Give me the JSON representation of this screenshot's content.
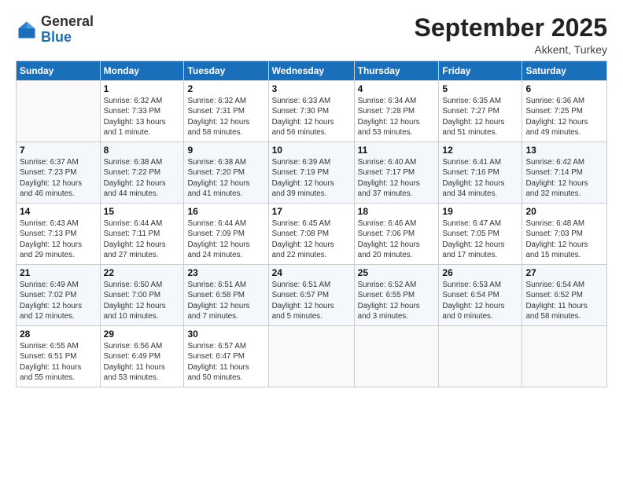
{
  "header": {
    "logo_general": "General",
    "logo_blue": "Blue",
    "month_title": "September 2025",
    "location": "Akkent, Turkey"
  },
  "days_of_week": [
    "Sunday",
    "Monday",
    "Tuesday",
    "Wednesday",
    "Thursday",
    "Friday",
    "Saturday"
  ],
  "weeks": [
    [
      {
        "day": "",
        "info": ""
      },
      {
        "day": "1",
        "info": "Sunrise: 6:32 AM\nSunset: 7:33 PM\nDaylight: 13 hours\nand 1 minute."
      },
      {
        "day": "2",
        "info": "Sunrise: 6:32 AM\nSunset: 7:31 PM\nDaylight: 12 hours\nand 58 minutes."
      },
      {
        "day": "3",
        "info": "Sunrise: 6:33 AM\nSunset: 7:30 PM\nDaylight: 12 hours\nand 56 minutes."
      },
      {
        "day": "4",
        "info": "Sunrise: 6:34 AM\nSunset: 7:28 PM\nDaylight: 12 hours\nand 53 minutes."
      },
      {
        "day": "5",
        "info": "Sunrise: 6:35 AM\nSunset: 7:27 PM\nDaylight: 12 hours\nand 51 minutes."
      },
      {
        "day": "6",
        "info": "Sunrise: 6:36 AM\nSunset: 7:25 PM\nDaylight: 12 hours\nand 49 minutes."
      }
    ],
    [
      {
        "day": "7",
        "info": "Sunrise: 6:37 AM\nSunset: 7:23 PM\nDaylight: 12 hours\nand 46 minutes."
      },
      {
        "day": "8",
        "info": "Sunrise: 6:38 AM\nSunset: 7:22 PM\nDaylight: 12 hours\nand 44 minutes."
      },
      {
        "day": "9",
        "info": "Sunrise: 6:38 AM\nSunset: 7:20 PM\nDaylight: 12 hours\nand 41 minutes."
      },
      {
        "day": "10",
        "info": "Sunrise: 6:39 AM\nSunset: 7:19 PM\nDaylight: 12 hours\nand 39 minutes."
      },
      {
        "day": "11",
        "info": "Sunrise: 6:40 AM\nSunset: 7:17 PM\nDaylight: 12 hours\nand 37 minutes."
      },
      {
        "day": "12",
        "info": "Sunrise: 6:41 AM\nSunset: 7:16 PM\nDaylight: 12 hours\nand 34 minutes."
      },
      {
        "day": "13",
        "info": "Sunrise: 6:42 AM\nSunset: 7:14 PM\nDaylight: 12 hours\nand 32 minutes."
      }
    ],
    [
      {
        "day": "14",
        "info": "Sunrise: 6:43 AM\nSunset: 7:13 PM\nDaylight: 12 hours\nand 29 minutes."
      },
      {
        "day": "15",
        "info": "Sunrise: 6:44 AM\nSunset: 7:11 PM\nDaylight: 12 hours\nand 27 minutes."
      },
      {
        "day": "16",
        "info": "Sunrise: 6:44 AM\nSunset: 7:09 PM\nDaylight: 12 hours\nand 24 minutes."
      },
      {
        "day": "17",
        "info": "Sunrise: 6:45 AM\nSunset: 7:08 PM\nDaylight: 12 hours\nand 22 minutes."
      },
      {
        "day": "18",
        "info": "Sunrise: 6:46 AM\nSunset: 7:06 PM\nDaylight: 12 hours\nand 20 minutes."
      },
      {
        "day": "19",
        "info": "Sunrise: 6:47 AM\nSunset: 7:05 PM\nDaylight: 12 hours\nand 17 minutes."
      },
      {
        "day": "20",
        "info": "Sunrise: 6:48 AM\nSunset: 7:03 PM\nDaylight: 12 hours\nand 15 minutes."
      }
    ],
    [
      {
        "day": "21",
        "info": "Sunrise: 6:49 AM\nSunset: 7:02 PM\nDaylight: 12 hours\nand 12 minutes."
      },
      {
        "day": "22",
        "info": "Sunrise: 6:50 AM\nSunset: 7:00 PM\nDaylight: 12 hours\nand 10 minutes."
      },
      {
        "day": "23",
        "info": "Sunrise: 6:51 AM\nSunset: 6:58 PM\nDaylight: 12 hours\nand 7 minutes."
      },
      {
        "day": "24",
        "info": "Sunrise: 6:51 AM\nSunset: 6:57 PM\nDaylight: 12 hours\nand 5 minutes."
      },
      {
        "day": "25",
        "info": "Sunrise: 6:52 AM\nSunset: 6:55 PM\nDaylight: 12 hours\nand 3 minutes."
      },
      {
        "day": "26",
        "info": "Sunrise: 6:53 AM\nSunset: 6:54 PM\nDaylight: 12 hours\nand 0 minutes."
      },
      {
        "day": "27",
        "info": "Sunrise: 6:54 AM\nSunset: 6:52 PM\nDaylight: 11 hours\nand 58 minutes."
      }
    ],
    [
      {
        "day": "28",
        "info": "Sunrise: 6:55 AM\nSunset: 6:51 PM\nDaylight: 11 hours\nand 55 minutes."
      },
      {
        "day": "29",
        "info": "Sunrise: 6:56 AM\nSunset: 6:49 PM\nDaylight: 11 hours\nand 53 minutes."
      },
      {
        "day": "30",
        "info": "Sunrise: 6:57 AM\nSunset: 6:47 PM\nDaylight: 11 hours\nand 50 minutes."
      },
      {
        "day": "",
        "info": ""
      },
      {
        "day": "",
        "info": ""
      },
      {
        "day": "",
        "info": ""
      },
      {
        "day": "",
        "info": ""
      }
    ]
  ]
}
